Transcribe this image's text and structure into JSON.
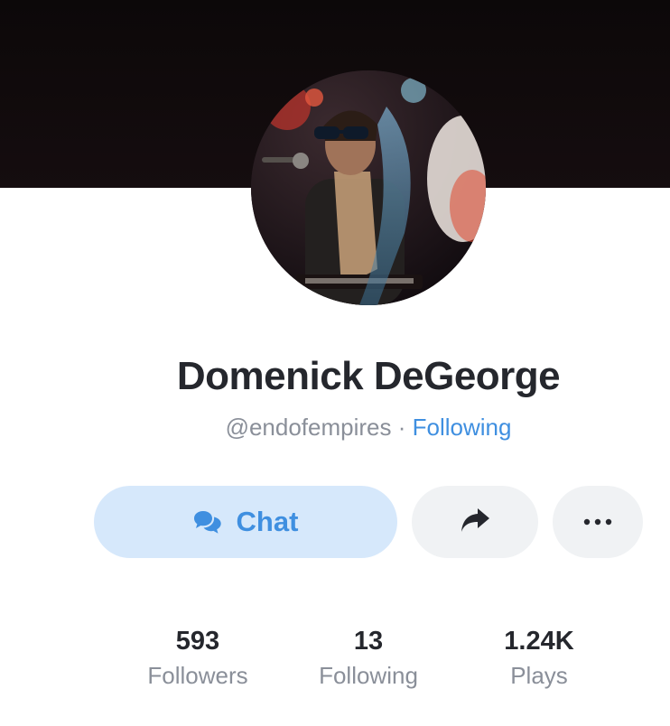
{
  "profile": {
    "name": "Domenick DeGeorge",
    "handle": "@endofempires",
    "separator": " · ",
    "follow_status": "Following"
  },
  "actions": {
    "chat_label": "Chat",
    "chat_icon": "chat-bubbles-icon",
    "share_icon": "share-arrow-icon",
    "more_icon": "more-dots-icon"
  },
  "stats": [
    {
      "value": "593",
      "label": "Followers"
    },
    {
      "value": "13",
      "label": "Following"
    },
    {
      "value": "1.24K",
      "label": "Plays"
    }
  ],
  "colors": {
    "accent": "#3f8fe0",
    "chat_button_bg": "#d6e8fb",
    "secondary_button_bg": "#f0f2f4",
    "text_primary": "#25272d",
    "text_muted": "#8a8f99",
    "cover_bg": "#0c0809"
  }
}
